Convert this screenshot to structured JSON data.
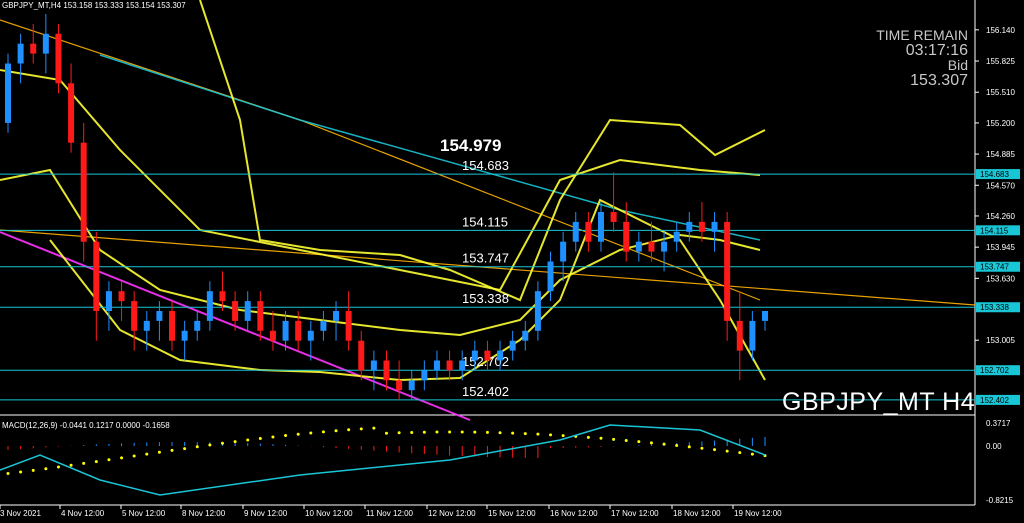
{
  "header": {
    "symbol_line": "GBPJPY_MT,H4  153.158 153.333 153.154 153.307",
    "macd_line": "MACD(12,26,9) -0.0441 0.1217 0.0000 -0.1658"
  },
  "info": {
    "time_remain_label": "TIME REMAIN",
    "time_remain_value": "03:17:16",
    "bid_label": "Bid",
    "bid_value": "153.307"
  },
  "symbol_tf": "GBPJPY_MT H4",
  "colors": {
    "background": "#000000",
    "bull_candle": "#1e90ff",
    "bear_candle": "#ff1a1a",
    "bands": "#ffff33",
    "ma_cyan": "#19c6d6",
    "trend_orange": "#ffb300",
    "trend_magenta": "#ff33ff",
    "level_line": "#19c6d6",
    "macd_signal": "#ffff00"
  },
  "chart_data": {
    "type": "candlestick",
    "ylim": [
      152.3,
      156.3
    ],
    "y_ticks": [
      "156.140",
      "155.825",
      "155.510",
      "155.200",
      "154.885",
      "154.570",
      "154.260",
      "153.945",
      "153.630",
      "153.005"
    ],
    "x_ticks": [
      "3 Nov 2021",
      "4 Nov 12:00",
      "5 Nov 12:00",
      "8 Nov 12:00",
      "9 Nov 12:00",
      "10 Nov 12:00",
      "11 Nov 12:00",
      "12 Nov 12:00",
      "15 Nov 12:00",
      "16 Nov 12:00",
      "17 Nov 12:00",
      "18 Nov 12:00",
      "19 Nov 12:00"
    ],
    "levels": [
      {
        "value": 154.683,
        "label": "154.683",
        "tag": "154.683"
      },
      {
        "value": 154.115,
        "label": "154.115",
        "tag": "154.115"
      },
      {
        "value": 153.747,
        "label": "153.747",
        "tag": "153.747"
      },
      {
        "value": 153.338,
        "label": "153.338",
        "tag": "153.338"
      },
      {
        "value": 152.702,
        "label": "152.702",
        "tag": "152.702"
      },
      {
        "value": 152.402,
        "label": "152.402",
        "tag": "152.402"
      }
    ],
    "high_label": {
      "text": "154.979",
      "value": 154.979
    },
    "candles": [
      [
        155.2,
        155.9,
        155.1,
        155.8
      ],
      [
        155.8,
        156.1,
        155.6,
        156.0
      ],
      [
        156.0,
        156.2,
        155.8,
        155.9
      ],
      [
        155.9,
        156.3,
        155.7,
        156.1
      ],
      [
        156.1,
        156.2,
        155.5,
        155.6
      ],
      [
        155.6,
        155.8,
        154.9,
        155.0
      ],
      [
        155.0,
        155.2,
        153.8,
        154.0
      ],
      [
        154.0,
        154.1,
        153.0,
        153.3
      ],
      [
        153.3,
        153.6,
        153.1,
        153.5
      ],
      [
        153.5,
        153.6,
        153.2,
        153.4
      ],
      [
        153.4,
        153.5,
        152.9,
        153.1
      ],
      [
        153.1,
        153.3,
        152.9,
        153.2
      ],
      [
        153.2,
        153.4,
        153.0,
        153.3
      ],
      [
        153.3,
        153.4,
        152.9,
        153.0
      ],
      [
        153.0,
        153.2,
        152.8,
        153.1
      ],
      [
        153.1,
        153.3,
        153.0,
        153.2
      ],
      [
        153.2,
        153.6,
        153.1,
        153.5
      ],
      [
        153.5,
        153.7,
        153.3,
        153.4
      ],
      [
        153.4,
        153.5,
        153.1,
        153.2
      ],
      [
        153.2,
        153.5,
        153.1,
        153.4
      ],
      [
        153.4,
        153.5,
        153.0,
        153.1
      ],
      [
        153.1,
        153.3,
        152.9,
        153.0
      ],
      [
        153.0,
        153.3,
        152.9,
        153.2
      ],
      [
        153.2,
        153.3,
        152.9,
        153.0
      ],
      [
        153.0,
        153.2,
        152.8,
        153.1
      ],
      [
        153.1,
        153.3,
        153.0,
        153.2
      ],
      [
        153.2,
        153.4,
        153.0,
        153.3
      ],
      [
        153.3,
        153.5,
        152.9,
        153.0
      ],
      [
        153.0,
        153.1,
        152.6,
        152.7
      ],
      [
        152.7,
        152.9,
        152.5,
        152.8
      ],
      [
        152.8,
        152.9,
        152.5,
        152.6
      ],
      [
        152.6,
        152.8,
        152.4,
        152.5
      ],
      [
        152.5,
        152.7,
        152.4,
        152.6
      ],
      [
        152.6,
        152.8,
        152.5,
        152.7
      ],
      [
        152.7,
        152.9,
        152.6,
        152.8
      ],
      [
        152.8,
        152.9,
        152.6,
        152.7
      ],
      [
        152.7,
        152.9,
        152.6,
        152.8
      ],
      [
        152.8,
        153.0,
        152.7,
        152.9
      ],
      [
        152.9,
        153.0,
        152.7,
        152.8
      ],
      [
        152.8,
        153.0,
        152.7,
        152.9
      ],
      [
        152.9,
        153.1,
        152.8,
        153.0
      ],
      [
        153.0,
        153.2,
        152.9,
        153.1
      ],
      [
        153.1,
        153.6,
        153.0,
        153.5
      ],
      [
        153.5,
        153.9,
        153.4,
        153.8
      ],
      [
        153.8,
        154.1,
        153.6,
        154.0
      ],
      [
        154.0,
        154.3,
        153.9,
        154.2
      ],
      [
        154.2,
        154.3,
        153.9,
        154.0
      ],
      [
        154.0,
        154.4,
        153.9,
        154.3
      ],
      [
        154.3,
        154.7,
        154.1,
        154.2
      ],
      [
        154.2,
        154.4,
        153.8,
        153.9
      ],
      [
        153.9,
        154.1,
        153.8,
        154.0
      ],
      [
        154.0,
        154.2,
        153.8,
        153.9
      ],
      [
        153.9,
        154.1,
        153.7,
        154.0
      ],
      [
        154.0,
        154.2,
        153.9,
        154.1
      ],
      [
        154.1,
        154.3,
        154.0,
        154.2
      ],
      [
        154.2,
        154.4,
        154.0,
        154.1
      ],
      [
        154.1,
        154.3,
        153.9,
        154.2
      ],
      [
        154.2,
        154.3,
        153.0,
        153.2
      ],
      [
        153.2,
        153.5,
        152.6,
        152.9
      ],
      [
        152.9,
        153.3,
        152.8,
        153.2
      ],
      [
        153.2,
        153.3,
        153.1,
        153.3
      ]
    ]
  }
}
